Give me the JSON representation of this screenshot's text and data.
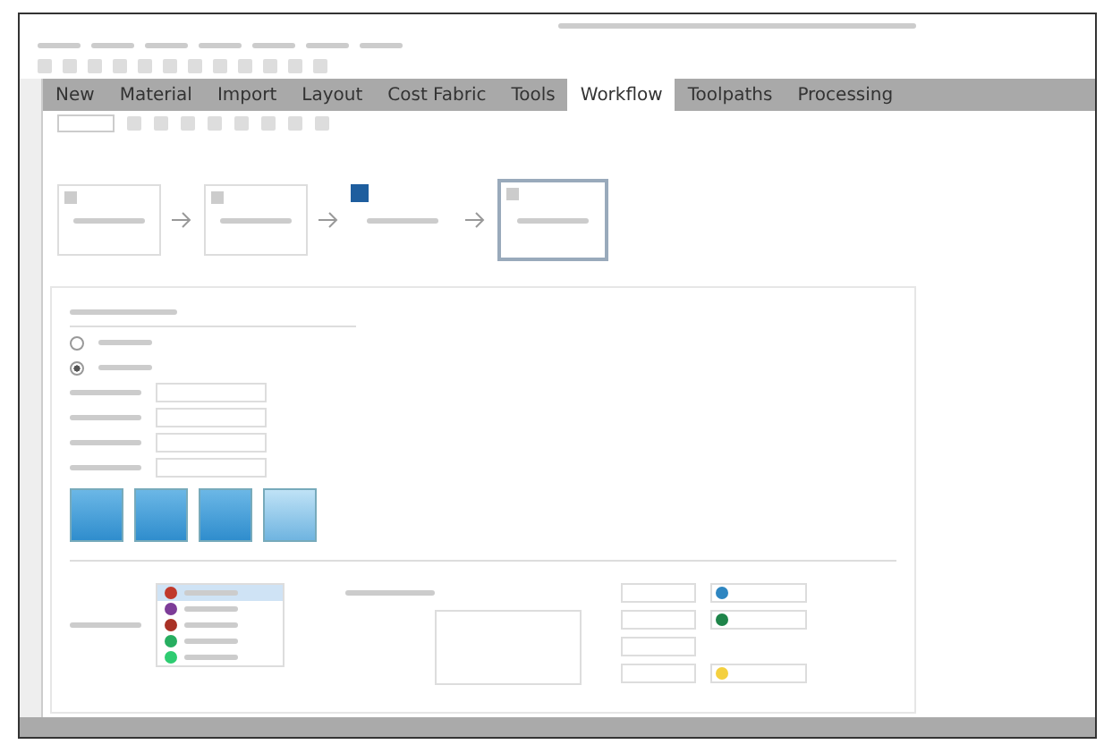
{
  "tabs": [
    {
      "label": "New",
      "selected": false
    },
    {
      "label": "Material",
      "selected": false
    },
    {
      "label": "Import",
      "selected": false
    },
    {
      "label": "Layout",
      "selected": false
    },
    {
      "label": "Cost Fabric",
      "selected": false
    },
    {
      "label": "Tools",
      "selected": false
    },
    {
      "label": "Workflow",
      "selected": true
    },
    {
      "label": "Toolpaths",
      "selected": false
    },
    {
      "label": "Processing",
      "selected": false
    }
  ],
  "workflow_nodes": [
    {
      "selected": false,
      "kind": "box"
    },
    {
      "selected": false,
      "kind": "box"
    },
    {
      "selected": false,
      "kind": "plain"
    },
    {
      "selected": true,
      "kind": "box"
    }
  ],
  "radios": [
    {
      "checked": false
    },
    {
      "checked": true
    }
  ],
  "mode_buttons": [
    {
      "selected": false
    },
    {
      "selected": false
    },
    {
      "selected": false
    },
    {
      "selected": true
    }
  ],
  "color_list": [
    {
      "color": "#c0392b",
      "selected": true
    },
    {
      "color": "#7d3c98",
      "selected": false
    },
    {
      "color": "#a93226",
      "selected": false
    },
    {
      "color": "#27ae60",
      "selected": false
    },
    {
      "color": "#2ecc71",
      "selected": false
    }
  ],
  "map_rows": [
    {
      "kind": "pair",
      "color": "#2e86c1"
    },
    {
      "kind": "pair",
      "color": "#1e8449"
    },
    {
      "kind": "single"
    },
    {
      "kind": "pair",
      "color": "#f4d03f"
    }
  ]
}
